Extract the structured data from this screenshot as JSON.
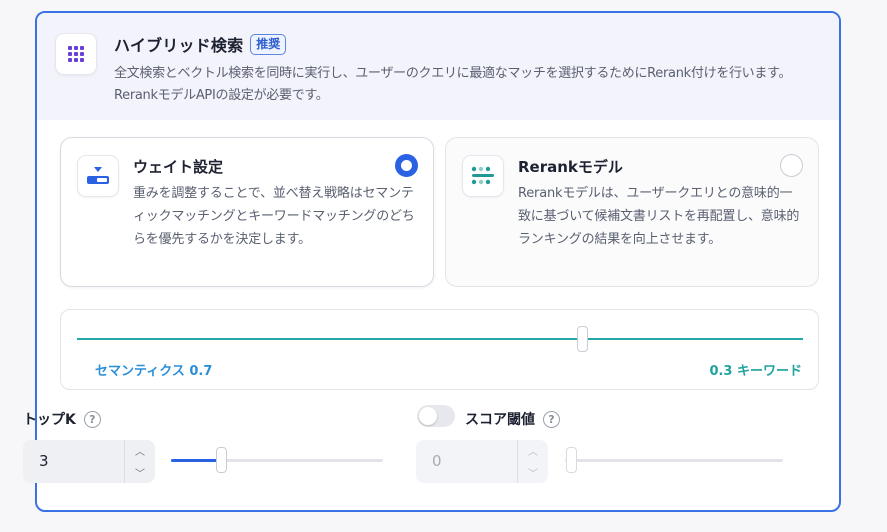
{
  "header": {
    "title": "ハイブリッド検索",
    "badge": "推奨",
    "description": "全文検索とベクトル検索を同時に実行し、ユーザーのクエリに最適なマッチを選択するためにRerank付けを行います。RerankモデルAPIの設定が必要です。",
    "icon": "grid-dots-icon"
  },
  "options": [
    {
      "title": "ウェイト設定",
      "description": "重みを調整することで、並べ替え戦略はセマンティックマッチングとキーワードマッチングのどちらを優先するかを決定します。",
      "selected": true,
      "icon": "weight-slider-icon"
    },
    {
      "title": "Rerankモデル",
      "description": "Rerankモデルは、ユーザークエリとの意味的一致に基づいて候補文書リストを再配置し、意味的ランキングの結果を向上させます。",
      "selected": false,
      "icon": "rerank-dots-icon"
    }
  ],
  "weights": {
    "semantic_label": "セマンティクス 0.7",
    "keyword_label": "0.3 キーワード",
    "semantic": 0.7,
    "keyword": 0.3
  },
  "top_k": {
    "label": "トップK",
    "value": "3",
    "help": "?"
  },
  "score_threshold": {
    "label": "スコア閾値",
    "value": "0",
    "enabled": false,
    "help": "?"
  },
  "colors": {
    "accent": "#2b62e3",
    "border": "#3a72e6",
    "semantic": "#2b8fd8",
    "keyword": "#1fa3a0"
  }
}
